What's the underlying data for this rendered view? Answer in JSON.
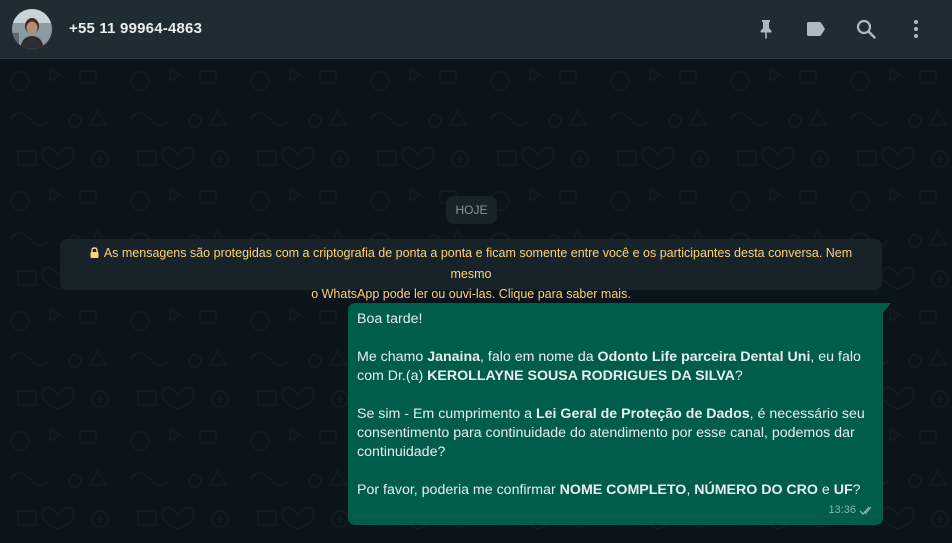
{
  "header": {
    "contact_name": "+55 11 99964-4863",
    "icons": [
      "pin-icon",
      "label-icon",
      "search-icon",
      "menu-dots-icon"
    ]
  },
  "chat": {
    "date_chip": "HOJE",
    "encryption_notice_line1": "As mensagens são protegidas com a criptografia de ponta a ponta e ficam somente entre você e os participantes desta conversa. Nem mesmo",
    "encryption_notice_line2": "o WhatsApp pode ler ou ouvi-las. Clique para saber mais.",
    "message": {
      "greeting": "Boa tarde!",
      "p2_a": "Me chamo ",
      "p2_name": "Janaina",
      "p2_b": ", falo em nome da ",
      "p2_company": "Odonto Life parceira Dental Uni",
      "p2_c": ", eu falo",
      "p2_d": "com Dr.(a) ",
      "p2_doctor": "KEROLLAYNE SOUSA RODRIGUES DA SILVA",
      "p2_e": "?",
      "p3_a": "Se sim - Em cumprimento a ",
      "p3_law": "Lei Geral de Proteção de Dados",
      "p3_b": ", é necessário seu",
      "p3_c": "consentimento para continuidade do atendimento por esse canal, podemos dar",
      "p3_d": "continuidade?",
      "p4_a": "Por favor, poderia me confirmar ",
      "p4_name": "NOME COMPLETO",
      "p4_sep": ", ",
      "p4_cro": "NÚMERO DO CRO",
      "p4_b": " e ",
      "p4_uf": "UF",
      "p4_c": "?",
      "time": "13:36",
      "status_icon": "double-check-icon"
    }
  },
  "colors": {
    "header_bg": "#202c33",
    "chat_bg": "#0b141a",
    "outgoing_bubble": "#005c4b",
    "notice_text": "#ffd279"
  }
}
